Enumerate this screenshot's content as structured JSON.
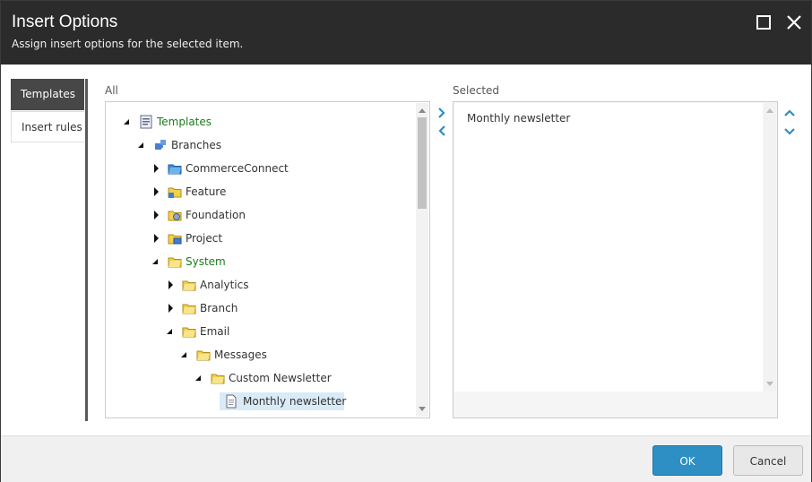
{
  "dialog": {
    "title": "Insert Options",
    "subtitle": "Assign insert options for the selected item.",
    "maximize_icon": "maximize-icon",
    "close_icon": "close-icon"
  },
  "tabs": [
    {
      "label": "Templates",
      "active": true
    },
    {
      "label": "Insert rules",
      "active": false
    }
  ],
  "all_label": "All",
  "selected_label": "Selected",
  "tree": [
    {
      "label": "Templates",
      "icon": "template-list-icon",
      "state": "expanded",
      "color": "green"
    },
    {
      "label": "Branches",
      "icon": "branch-puzzle-icon",
      "state": "expanded"
    },
    {
      "label": "CommerceConnect",
      "icon": "folder-blue-icon",
      "state": "collapsed"
    },
    {
      "label": "Feature",
      "icon": "folder-feature-icon",
      "state": "collapsed"
    },
    {
      "label": "Foundation",
      "icon": "folder-foundation-icon",
      "state": "collapsed"
    },
    {
      "label": "Project",
      "icon": "folder-project-icon",
      "state": "collapsed"
    },
    {
      "label": "System",
      "icon": "folder-icon",
      "state": "expanded",
      "color": "green"
    },
    {
      "label": "Analytics",
      "icon": "folder-icon",
      "state": "collapsed"
    },
    {
      "label": "Branch",
      "icon": "folder-icon",
      "state": "collapsed"
    },
    {
      "label": "Email",
      "icon": "folder-icon",
      "state": "expanded"
    },
    {
      "label": "Messages",
      "icon": "folder-icon",
      "state": "expanded"
    },
    {
      "label": "Custom Newsletter",
      "icon": "folder-icon",
      "state": "expanded"
    },
    {
      "label": "Monthly newsletter",
      "icon": "document-icon",
      "state": "leaf",
      "selected": true
    }
  ],
  "selected_items": [
    "Monthly newsletter"
  ],
  "move_buttons": {
    "add_icon": "chevron-right-icon",
    "remove_icon": "chevron-left-icon"
  },
  "order_buttons": {
    "up_icon": "chevron-up-icon",
    "down_icon": "chevron-down-icon"
  },
  "footer": {
    "ok_label": "OK",
    "cancel_label": "Cancel"
  },
  "colors": {
    "accent": "#2d8fc4",
    "titlebar": "#2b2b2b",
    "tree_green": "#1d7a1d",
    "chevron": "#2d8fc4"
  }
}
